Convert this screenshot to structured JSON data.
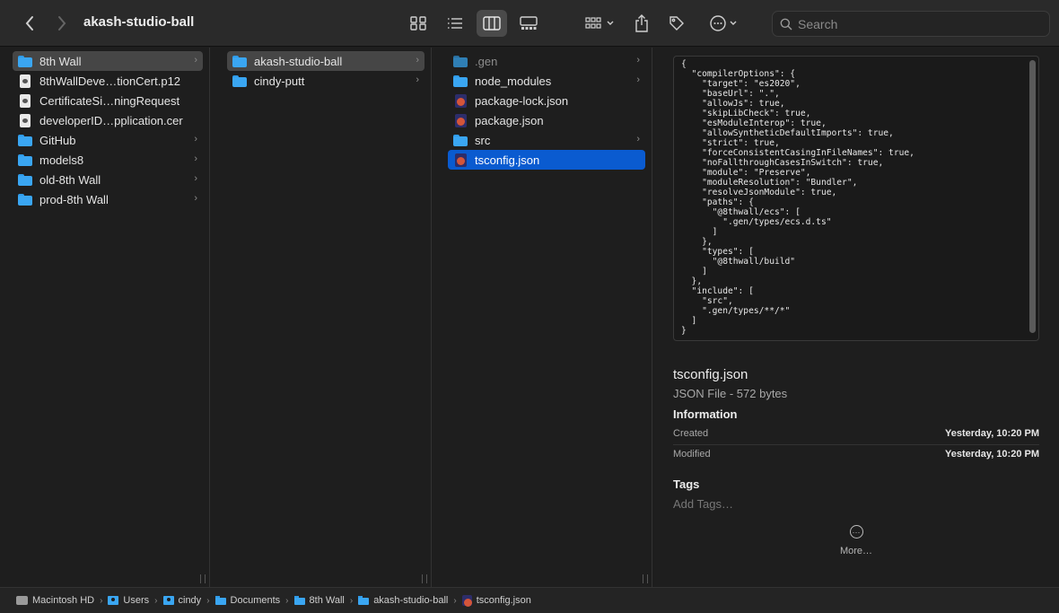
{
  "window": {
    "title": "akash-studio-ball"
  },
  "search": {
    "placeholder": "Search"
  },
  "toolbar": {
    "icons": [
      "back-icon",
      "forward-icon",
      "icon-view-icon",
      "list-view-icon",
      "column-view-icon",
      "gallery-view-icon",
      "group-icon",
      "share-icon",
      "tag-icon",
      "more-actions-icon",
      "search-icon"
    ]
  },
  "columns": {
    "c1": [
      {
        "label": "8th Wall",
        "type": "folder"
      },
      {
        "label": "8thWallDeve…tionCert.p12",
        "type": "file"
      },
      {
        "label": "CertificateSi…ningRequest",
        "type": "file"
      },
      {
        "label": "developerID…pplication.cer",
        "type": "file"
      },
      {
        "label": "GitHub",
        "type": "folder"
      },
      {
        "label": "models8",
        "type": "folder"
      },
      {
        "label": "old-8th Wall",
        "type": "folder"
      },
      {
        "label": "prod-8th Wall",
        "type": "folder"
      }
    ],
    "c2": [
      {
        "label": "akash-studio-ball",
        "type": "folder"
      },
      {
        "label": "cindy-putt",
        "type": "folder"
      }
    ],
    "c3": [
      {
        "label": ".gen",
        "type": "folder"
      },
      {
        "label": "node_modules",
        "type": "folder"
      },
      {
        "label": "package-lock.json",
        "type": "json"
      },
      {
        "label": "package.json",
        "type": "json"
      },
      {
        "label": "src",
        "type": "folder"
      },
      {
        "label": "tsconfig.json",
        "type": "json"
      }
    ]
  },
  "preview": {
    "code": "{\n  \"compilerOptions\": {\n    \"target\": \"es2020\",\n    \"baseUrl\": \".\",\n    \"allowJs\": true,\n    \"skipLibCheck\": true,\n    \"esModuleInterop\": true,\n    \"allowSyntheticDefaultImports\": true,\n    \"strict\": true,\n    \"forceConsistentCasingInFileNames\": true,\n    \"noFallthroughCasesInSwitch\": true,\n    \"module\": \"Preserve\",\n    \"moduleResolution\": \"Bundler\",\n    \"resolveJsonModule\": true,\n    \"paths\": {\n      \"@8thwall/ecs\": [\n        \".gen/types/ecs.d.ts\"\n      ]\n    },\n    \"types\": [\n      \"@8thwall/build\"\n    ]\n  },\n  \"include\": [\n    \"src\",\n    \".gen/types/**/*\"\n  ]\n}",
    "file_name": "tsconfig.json",
    "file_kind": "JSON File - 572 bytes",
    "info_heading": "Information",
    "created_label": "Created",
    "created_value": "Yesterday, 10:20 PM",
    "modified_label": "Modified",
    "modified_value": "Yesterday, 10:20 PM",
    "tags_heading": "Tags",
    "tags_placeholder": "Add Tags…",
    "more_label": "More…"
  },
  "pathbar": [
    "Macintosh HD",
    "Users",
    "cindy",
    "Documents",
    "8th Wall",
    "akash-studio-ball",
    "tsconfig.json"
  ],
  "colors": {
    "selection": "#0a5bd0",
    "folder": "#3aa6f2"
  }
}
